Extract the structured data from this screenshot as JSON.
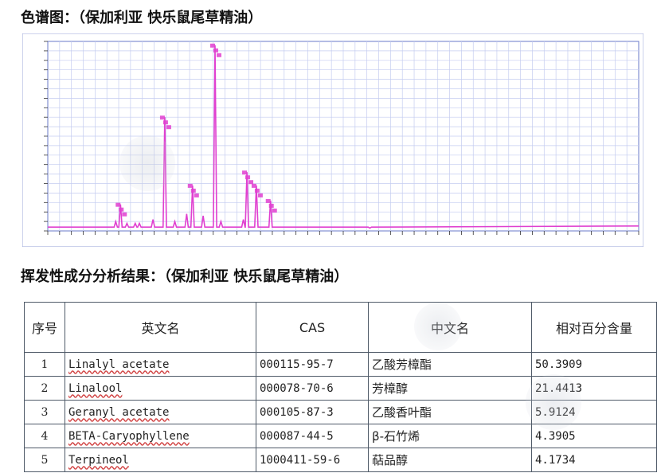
{
  "chart_title": "色谱图：（保加利亚 快乐鼠尾草精油）",
  "results_title": "挥发性成分分析结果：（保加利亚 快乐鼠尾草精油）",
  "colors": {
    "signal": "#e040d0",
    "grid": "#c4ccf0",
    "frame": "#6a7ac8",
    "table_border": "#4f5a68"
  },
  "chart_data": {
    "type": "line",
    "title": "",
    "xlabel": "",
    "ylabel": "",
    "xlim": [
      0,
      100
    ],
    "ylim": [
      0,
      100
    ],
    "grid": true,
    "baseline": 2,
    "peaks": [
      {
        "x": 11.5,
        "y": 5
      },
      {
        "x": 12.3,
        "y": 14
      },
      {
        "x": 13.4,
        "y": 4
      },
      {
        "x": 14.8,
        "y": 4
      },
      {
        "x": 15.5,
        "y": 4
      },
      {
        "x": 17.8,
        "y": 6
      },
      {
        "x": 19.8,
        "y": 60
      },
      {
        "x": 21.5,
        "y": 5
      },
      {
        "x": 23.5,
        "y": 9
      },
      {
        "x": 24.5,
        "y": 24
      },
      {
        "x": 26.3,
        "y": 8
      },
      {
        "x": 28.3,
        "y": 98
      },
      {
        "x": 29.3,
        "y": 5
      },
      {
        "x": 33.1,
        "y": 6
      },
      {
        "x": 33.7,
        "y": 31
      },
      {
        "x": 35.3,
        "y": 24
      },
      {
        "x": 37.7,
        "y": 16
      },
      {
        "x": 54.5,
        "y": 1.5
      }
    ]
  },
  "table": {
    "headers": [
      "序号",
      "英文名",
      "CAS",
      "中文名",
      "相对百分含量"
    ],
    "rows": [
      {
        "idx": "1",
        "en": "Linalyl acetate",
        "cas": "000115-95-7",
        "zh": "乙酸芳樟酯",
        "pct": "50.3909"
      },
      {
        "idx": "2",
        "en": "Linalool",
        "cas": "000078-70-6",
        "zh": "芳樟醇",
        "pct": "21.4413"
      },
      {
        "idx": "3",
        "en": "Geranyl acetate",
        "cas": "000105-87-3",
        "zh": "乙酸香叶酯",
        "pct": "5.9124"
      },
      {
        "idx": "4",
        "en": "BETA-Caryophyllene",
        "cas": "000087-44-5",
        "zh": "β-石竹烯",
        "pct": "4.3905"
      },
      {
        "idx": "5",
        "en": "Terpineol",
        "cas": "1000411-59-6",
        "zh": "萜品醇",
        "pct": "4.1734"
      }
    ]
  }
}
